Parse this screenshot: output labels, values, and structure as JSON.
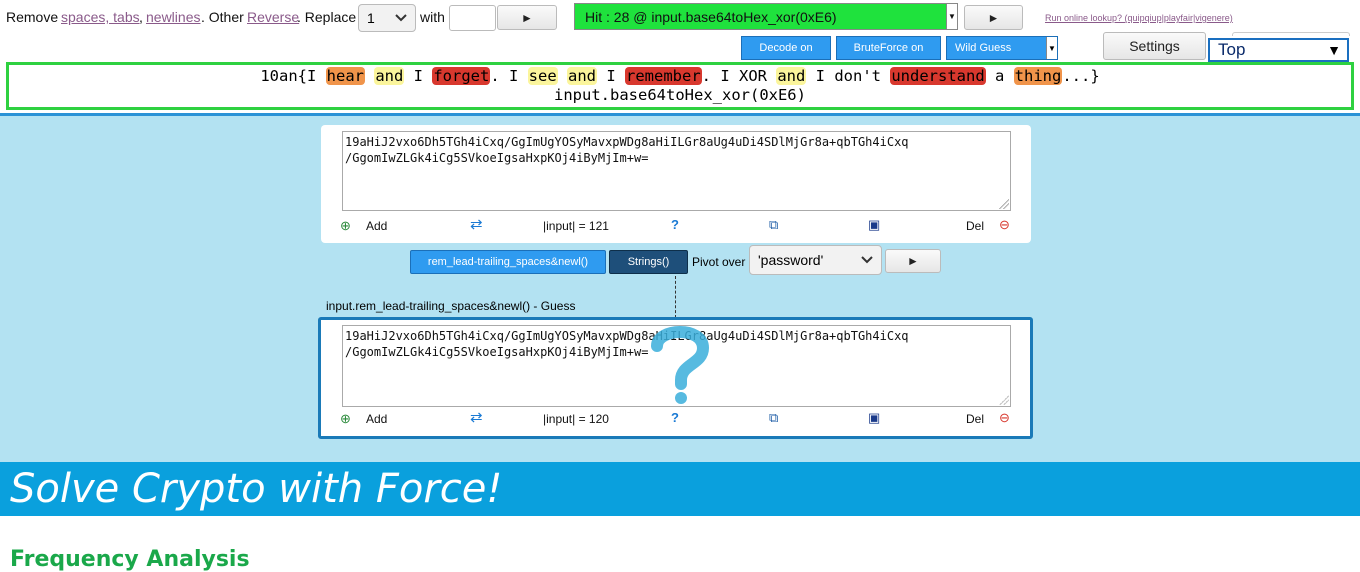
{
  "toolbar": {
    "remove_label": "Remove",
    "spaces_tabs_link": "spaces, tabs",
    "comma": ",",
    "newlines_link": "newlines",
    "period_other": ". Other",
    "reverse_link": "Reverse",
    "period_replace": ". Replace",
    "replace_count": "1",
    "with_label": "with",
    "with_value": "",
    "play_glyph": "►",
    "hit_selected": "Hit : 28 @ input.base64toHex_xor(0xE6)",
    "lookup_link": "Run online lookup? (quipqiup|playfair|vigenere)",
    "decode_on": "Decode on",
    "bruteforce_on": "BruteForce on",
    "wild_guess": "Wild Guess",
    "settings": "Settings",
    "top_select": "Top"
  },
  "output": {
    "line1": [
      {
        "t": "10an{I ",
        "h": ""
      },
      {
        "t": "hear",
        "h": "o"
      },
      {
        "t": " ",
        "h": ""
      },
      {
        "t": "and",
        "h": "y"
      },
      {
        "t": " I ",
        "h": ""
      },
      {
        "t": "forget",
        "h": "r"
      },
      {
        "t": ". I ",
        "h": ""
      },
      {
        "t": "see",
        "h": "y"
      },
      {
        "t": " ",
        "h": ""
      },
      {
        "t": "and",
        "h": "y"
      },
      {
        "t": " I ",
        "h": ""
      },
      {
        "t": "remember",
        "h": "r"
      },
      {
        "t": ". I XOR ",
        "h": ""
      },
      {
        "t": "and",
        "h": "y"
      },
      {
        "t": " I don't ",
        "h": ""
      },
      {
        "t": "understand",
        "h": "r"
      },
      {
        "t": " a ",
        "h": ""
      },
      {
        "t": "thing",
        "h": "o"
      },
      {
        "t": "...}",
        "h": ""
      }
    ],
    "line2": "input.base64toHex_xor(0xE6)"
  },
  "card1": {
    "text_line1": "19aHiJ2vxo6Dh5TGh4iCxq/GgImUgYOSyMavxpWDg8aHiILGr8aUg4uDi4SDlMjGr8a+qbTGh4iCxq",
    "text_line2": "/GgomIwZLGk4iCg5SVkoeIgsaHxpKOj4iByMjIm+w=",
    "add": "Add",
    "length": "|input| = 121",
    "help": "?",
    "del": "Del"
  },
  "middle": {
    "strip_button": "rem_lead-trailing_spaces&newl()",
    "strings_button": "Strings()",
    "pivot_label": "Pivot over",
    "pivot_value": "'password'",
    "play_glyph": "►"
  },
  "card2": {
    "title": "input.rem_lead-trailing_spaces&newl() - Guess",
    "text_line1": "19aHiJ2vxo6Dh5TGh4iCxq/GgImUgYOSyMavxpWDg8aHiILGr8aUg4uDi4SDlMjGr8a+qbTGh4iCxq",
    "text_line2": "/GgomIwZLGk4iCg5SVkoeIgsaHxpKOj4iByMjIm+w=",
    "add": "Add",
    "length": "|input| = 120",
    "help": "?",
    "del": "Del"
  },
  "banner": "Solve Crypto with Force!",
  "frequency_heading": "Frequency Analysis",
  "colors": {
    "hit_green": "#1fe23d",
    "output_border": "#2ed140",
    "work_bg": "#b3e2f2",
    "banner_bg": "#0aa0dd",
    "button_blue": "#2f9bf0",
    "button_navy": "#1e4f7a"
  },
  "icons": [
    "add-circle-icon",
    "refresh-icon",
    "help-icon",
    "copy-icon",
    "save-icon",
    "remove-circle-icon",
    "chevron-down-icon",
    "play-icon",
    "question-mark-watermark-icon"
  ]
}
